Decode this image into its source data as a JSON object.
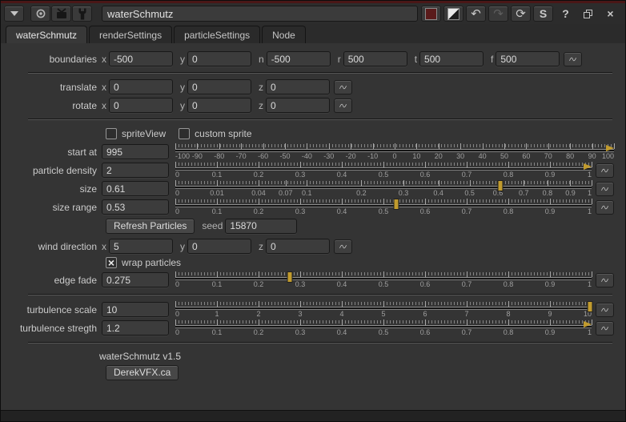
{
  "titlebar": {
    "node_name": "waterSchmutz",
    "icons": {
      "undo": "↶",
      "redo": "↷",
      "revert": "⟳",
      "help": "?",
      "s": "S",
      "close": "×"
    }
  },
  "tabs": {
    "items": [
      {
        "label": "waterSchmutz"
      },
      {
        "label": "renderSettings"
      },
      {
        "label": "particleSettings"
      },
      {
        "label": "Node"
      }
    ]
  },
  "rows": {
    "boundaries": {
      "label": "boundaries",
      "fields": [
        {
          "k": "x",
          "v": "-500"
        },
        {
          "k": "y",
          "v": "0"
        },
        {
          "k": "n",
          "v": "-500"
        },
        {
          "k": "r",
          "v": "500"
        },
        {
          "k": "t",
          "v": "500"
        },
        {
          "k": "f",
          "v": "500"
        }
      ]
    },
    "translate": {
      "label": "translate",
      "fields": [
        {
          "k": "x",
          "v": "0"
        },
        {
          "k": "y",
          "v": "0"
        },
        {
          "k": "z",
          "v": "0"
        }
      ]
    },
    "rotate": {
      "label": "rotate",
      "fields": [
        {
          "k": "x",
          "v": "0"
        },
        {
          "k": "y",
          "v": "0"
        },
        {
          "k": "z",
          "v": "0"
        }
      ]
    },
    "sprite_view": {
      "label": "spriteView",
      "checked": false,
      "mark": ""
    },
    "custom_sprite": {
      "label": "custom sprite",
      "checked": false,
      "mark": ""
    },
    "start_at": {
      "label": "start at",
      "value": "995"
    },
    "particle_density": {
      "label": "particle density",
      "value": "2"
    },
    "size": {
      "label": "size",
      "value": "0.61"
    },
    "size_range": {
      "label": "size range",
      "value": "0.53"
    },
    "refresh": {
      "button": "Refresh Particles",
      "seed_label": "seed",
      "seed": "15870"
    },
    "wind_direction": {
      "label": "wind direction",
      "fields": [
        {
          "k": "x",
          "v": "5"
        },
        {
          "k": "y",
          "v": "0"
        },
        {
          "k": "z",
          "v": "0"
        }
      ]
    },
    "wrap_particles": {
      "label": "wrap particles",
      "checked": true,
      "mark": "×"
    },
    "edge_fade": {
      "label": "edge fade",
      "value": "0.275"
    },
    "turbulence_scale": {
      "label": "turbulence scale",
      "value": "10"
    },
    "turbulence_stregth": {
      "label": "turbulence stregth",
      "value": "1.2"
    }
  },
  "sliders": {
    "start_at": {
      "range": [
        -100,
        100
      ],
      "ticks": [
        {
          "t": "-100",
          "p": 0
        },
        {
          "t": "-90",
          "p": 5
        },
        {
          "t": "-80",
          "p": 10
        },
        {
          "t": "-70",
          "p": 15
        },
        {
          "t": "-60",
          "p": 20
        },
        {
          "t": "-50",
          "p": 25
        },
        {
          "t": "-40",
          "p": 30
        },
        {
          "t": "-30",
          "p": 35
        },
        {
          "t": "-20",
          "p": 40
        },
        {
          "t": "-10",
          "p": 45
        },
        {
          "t": "0",
          "p": 50
        },
        {
          "t": "10",
          "p": 55
        },
        {
          "t": "20",
          "p": 60
        },
        {
          "t": "30",
          "p": 65
        },
        {
          "t": "40",
          "p": 70
        },
        {
          "t": "50",
          "p": 75
        },
        {
          "t": "60",
          "p": 80
        },
        {
          "t": "70",
          "p": 85
        },
        {
          "t": "80",
          "p": 90
        },
        {
          "t": "90",
          "p": 95
        },
        {
          "t": "100",
          "p": 100
        }
      ],
      "handle": {
        "p": 100,
        "style": "arrow"
      }
    },
    "particle_density": {
      "range": [
        0,
        1
      ],
      "ticks": [
        {
          "t": "0",
          "p": 0
        },
        {
          "t": "0.1",
          "p": 10
        },
        {
          "t": "0.2",
          "p": 20
        },
        {
          "t": "0.3",
          "p": 30
        },
        {
          "t": "0.4",
          "p": 40
        },
        {
          "t": "0.5",
          "p": 50
        },
        {
          "t": "0.6",
          "p": 60
        },
        {
          "t": "0.7",
          "p": 70
        },
        {
          "t": "0.8",
          "p": 80
        },
        {
          "t": "0.9",
          "p": 90
        },
        {
          "t": "1",
          "p": 100
        }
      ],
      "handle": {
        "p": 100,
        "style": "arrow"
      }
    },
    "size": {
      "range": [
        0,
        1
      ],
      "scale": "sqrt",
      "ticks": [
        {
          "t": "0",
          "p": 0
        },
        {
          "t": "0.01",
          "p": 10
        },
        {
          "t": "0.04",
          "p": 20
        },
        {
          "t": "0.07",
          "p": 26.5
        },
        {
          "t": "0.1",
          "p": 31.6
        },
        {
          "t": "0.2",
          "p": 44.7
        },
        {
          "t": "0.3",
          "p": 54.8
        },
        {
          "t": "0.4",
          "p": 63.2
        },
        {
          "t": "0.5",
          "p": 70.7
        },
        {
          "t": "0.6",
          "p": 77.5
        },
        {
          "t": "0.7",
          "p": 83.7
        },
        {
          "t": "0.8",
          "p": 89.4
        },
        {
          "t": "0.9",
          "p": 94.9
        },
        {
          "t": "1",
          "p": 100
        }
      ],
      "handle": {
        "p": 78.1,
        "style": "bar"
      }
    },
    "size_range": {
      "range": [
        0,
        1
      ],
      "ticks": [
        {
          "t": "0",
          "p": 0
        },
        {
          "t": "0.1",
          "p": 10
        },
        {
          "t": "0.2",
          "p": 20
        },
        {
          "t": "0.3",
          "p": 30
        },
        {
          "t": "0.4",
          "p": 40
        },
        {
          "t": "0.5",
          "p": 50
        },
        {
          "t": "0.6",
          "p": 60
        },
        {
          "t": "0.7",
          "p": 70
        },
        {
          "t": "0.8",
          "p": 80
        },
        {
          "t": "0.9",
          "p": 90
        },
        {
          "t": "1",
          "p": 100
        }
      ],
      "handle": {
        "p": 53,
        "style": "bar"
      }
    },
    "edge_fade": {
      "range": [
        0,
        1
      ],
      "ticks": [
        {
          "t": "0",
          "p": 0
        },
        {
          "t": "0.1",
          "p": 10
        },
        {
          "t": "0.2",
          "p": 20
        },
        {
          "t": "0.3",
          "p": 30
        },
        {
          "t": "0.4",
          "p": 40
        },
        {
          "t": "0.5",
          "p": 50
        },
        {
          "t": "0.6",
          "p": 60
        },
        {
          "t": "0.7",
          "p": 70
        },
        {
          "t": "0.8",
          "p": 80
        },
        {
          "t": "0.9",
          "p": 90
        },
        {
          "t": "1",
          "p": 100
        }
      ],
      "handle": {
        "p": 27.5,
        "style": "bar"
      }
    },
    "turbulence_scale": {
      "range": [
        0,
        10
      ],
      "ticks": [
        {
          "t": "0",
          "p": 0
        },
        {
          "t": "1",
          "p": 10
        },
        {
          "t": "2",
          "p": 20
        },
        {
          "t": "3",
          "p": 30
        },
        {
          "t": "4",
          "p": 40
        },
        {
          "t": "5",
          "p": 50
        },
        {
          "t": "6",
          "p": 60
        },
        {
          "t": "7",
          "p": 70
        },
        {
          "t": "8",
          "p": 80
        },
        {
          "t": "9",
          "p": 90
        },
        {
          "t": "10",
          "p": 100
        }
      ],
      "handle": {
        "p": 99.6,
        "style": "bar"
      }
    },
    "turbulence_stregth": {
      "range": [
        0,
        1
      ],
      "ticks": [
        {
          "t": "0",
          "p": 0
        },
        {
          "t": "0.1",
          "p": 10
        },
        {
          "t": "0.2",
          "p": 20
        },
        {
          "t": "0.3",
          "p": 30
        },
        {
          "t": "0.4",
          "p": 40
        },
        {
          "t": "0.5",
          "p": 50
        },
        {
          "t": "0.6",
          "p": 60
        },
        {
          "t": "0.7",
          "p": 70
        },
        {
          "t": "0.8",
          "p": 80
        },
        {
          "t": "0.9",
          "p": 90
        },
        {
          "t": "1",
          "p": 100
        }
      ],
      "handle": {
        "p": 100,
        "style": "arrow"
      }
    }
  },
  "footer": {
    "version": "waterSchmutz v1.5",
    "link": "DerekVFX.ca"
  },
  "colors": {
    "accent": "#c19b2e",
    "title_accent": "#4a1717",
    "node_swatch": "#5a1b1b"
  }
}
